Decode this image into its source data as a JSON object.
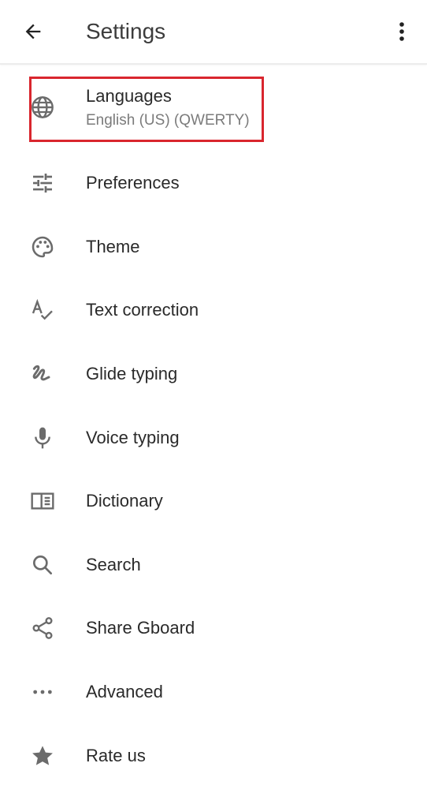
{
  "header": {
    "title": "Settings",
    "back_icon": "arrow-back-icon",
    "menu_icon": "more-vert-icon"
  },
  "items": [
    {
      "icon": "globe-icon",
      "label": "Languages",
      "sublabel": "English (US) (QWERTY)",
      "highlighted": true
    },
    {
      "icon": "tune-sliders-icon",
      "label": "Preferences"
    },
    {
      "icon": "palette-icon",
      "label": "Theme"
    },
    {
      "icon": "spellcheck-icon",
      "label": "Text correction"
    },
    {
      "icon": "gesture-icon",
      "label": "Glide typing"
    },
    {
      "icon": "microphone-icon",
      "label": "Voice typing"
    },
    {
      "icon": "book-icon",
      "label": "Dictionary"
    },
    {
      "icon": "search-icon",
      "label": "Search"
    },
    {
      "icon": "share-icon",
      "label": "Share Gboard"
    },
    {
      "icon": "more-horiz-icon",
      "label": "Advanced"
    },
    {
      "icon": "star-icon",
      "label": "Rate us"
    }
  ],
  "colors": {
    "highlight_border": "#d9262e",
    "icon": "#6b6b6b",
    "label": "#2a2a2a",
    "sublabel": "#7b7b7b"
  }
}
